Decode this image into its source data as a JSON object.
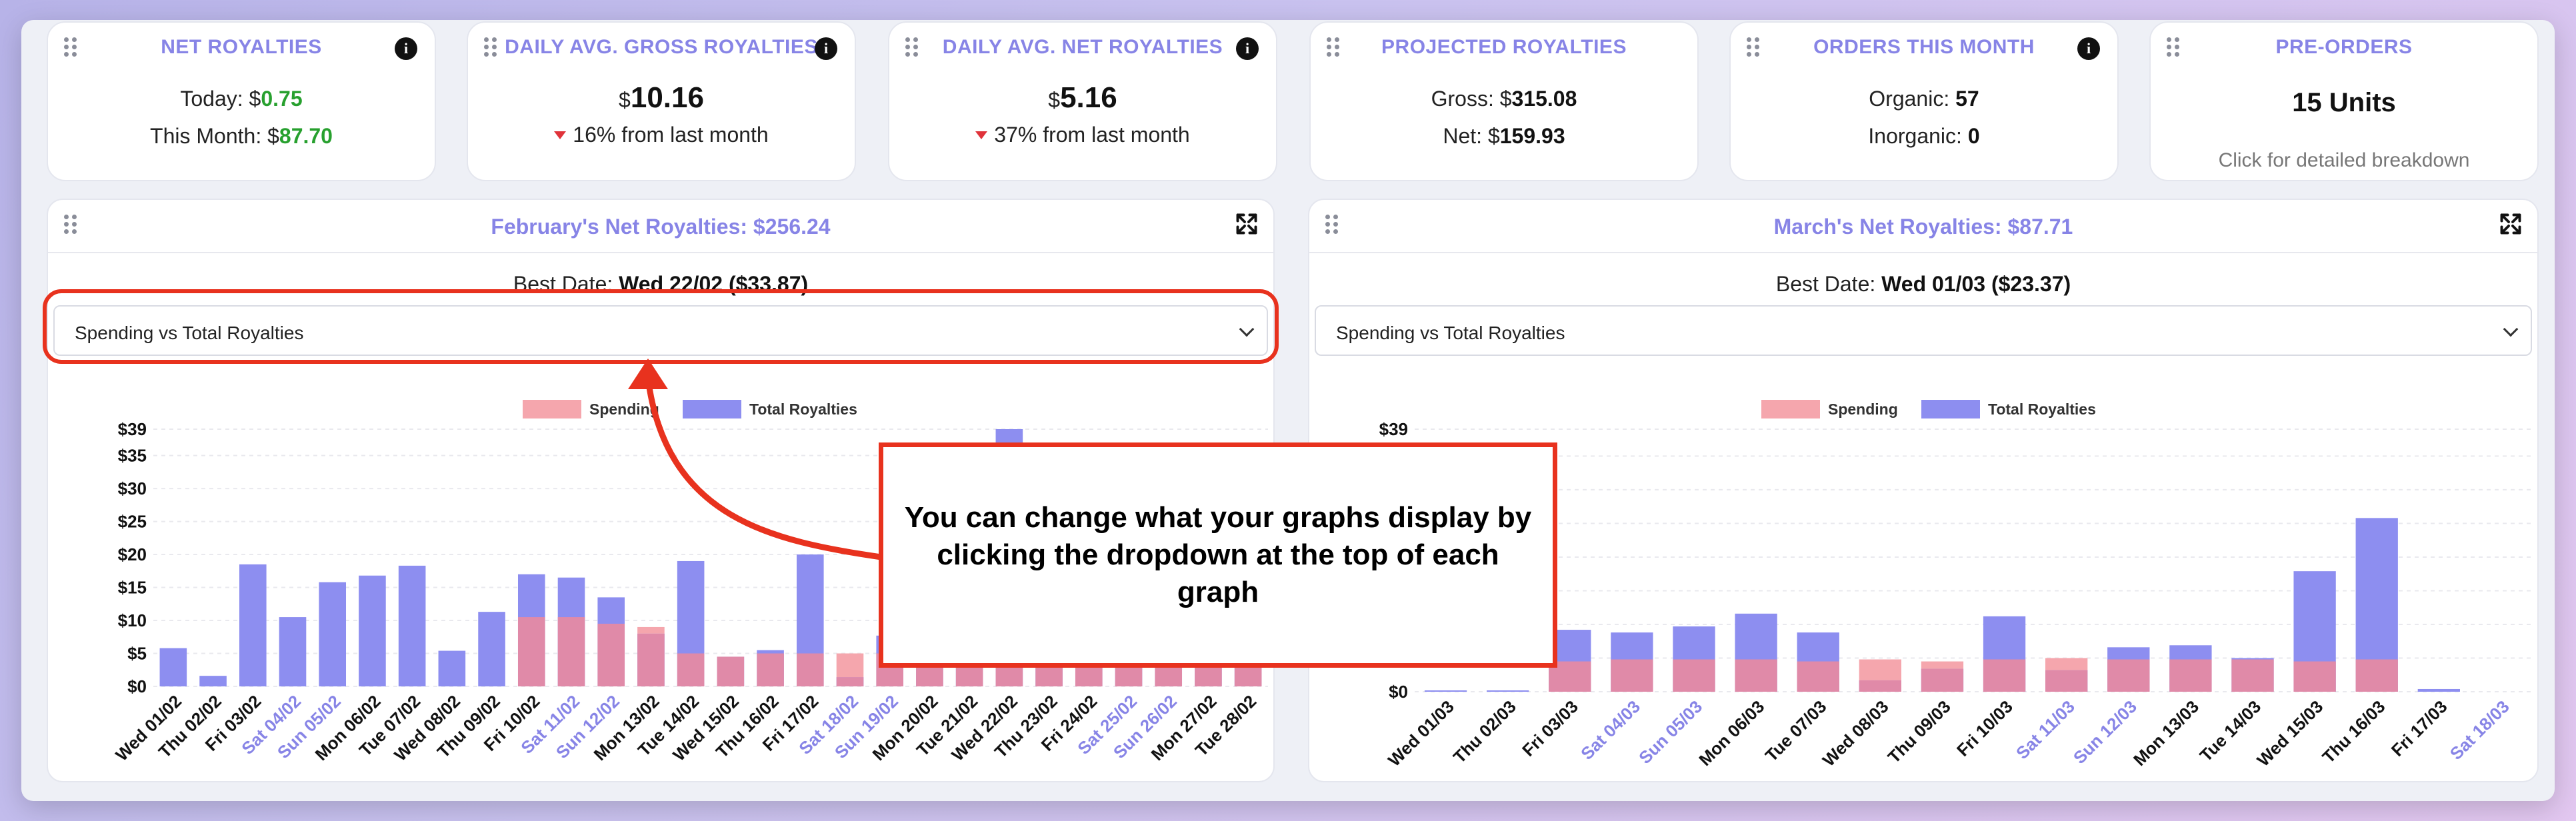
{
  "stats": {
    "net": {
      "title": "NET ROYALTIES",
      "today_label": "Today: $",
      "today_value": "0.75",
      "month_label": "This Month: $",
      "month_value": "87.70"
    },
    "gross": {
      "title": "DAILY AVG. GROSS ROYALTIES",
      "value_prefix": "$",
      "value": "10.16",
      "change": "16% from last month"
    },
    "netavg": {
      "title": "DAILY AVG. NET ROYALTIES",
      "value_prefix": "$",
      "value": "5.16",
      "change": "37% from last month"
    },
    "projected": {
      "title": "PROJECTED ROYALTIES",
      "gross_label": "Gross: $",
      "gross_value": "315.08",
      "net_label": "Net: $",
      "net_value": "159.93"
    },
    "orders": {
      "title": "ORDERS THIS MONTH",
      "organic_label": "Organic: ",
      "organic_value": "57",
      "inorganic_label": "Inorganic: ",
      "inorganic_value": "0"
    },
    "preorders": {
      "title": "PRE-ORDERS",
      "value": "15 Units",
      "hint": "Click for detailed breakdown"
    }
  },
  "graph_left": {
    "title_prefix": "February's Net Royalties: $",
    "title_value": "256.24",
    "best_label": "Best Date: ",
    "best_value": "Wed 22/02 ($33.87)",
    "select_value": "Spending vs Total Royalties"
  },
  "graph_right": {
    "title_prefix": "March's Net Royalties: $",
    "title_value": "87.71",
    "best_label": "Best Date: ",
    "best_value": "Wed 01/03 ($23.37)",
    "select_value": "Spending vs Total Royalties"
  },
  "callout": {
    "text": "You can change what your graphs display by clicking the dropdown at the top of each graph"
  },
  "colors": {
    "accent": "#8784e6",
    "spending": "#f5a6ad",
    "royalties": "#8d8ef0",
    "overlap": "#e08aa8",
    "highlight": "#e8321e",
    "weekend_label": "#8784e6"
  },
  "chart_data": [
    {
      "type": "bar",
      "legend": [
        "Spending",
        "Total Royalties"
      ],
      "ticks": [
        "$0",
        "$5",
        "$10",
        "$15",
        "$20",
        "$25",
        "$30",
        "$35",
        "$39"
      ],
      "ylim": [
        0,
        39
      ],
      "categories": [
        "Wed 01/02",
        "Thu 02/02",
        "Fri 03/02",
        "Sat 04/02",
        "Sun 05/02",
        "Mon 06/02",
        "Tue 07/02",
        "Wed 08/02",
        "Thu 09/02",
        "Fri 10/02",
        "Sat 11/02",
        "Sun 12/02",
        "Mon 13/02",
        "Tue 14/02",
        "Wed 15/02",
        "Thu 16/02",
        "Fri 17/02",
        "Sat 18/02",
        "Sun 19/02",
        "Mon 20/02",
        "Tue 21/02",
        "Wed 22/02",
        "Thu 23/02",
        "Fri 24/02",
        "Sat 25/02",
        "Sun 26/02",
        "Mon 27/02",
        "Tue 28/02"
      ],
      "weekend": [
        3,
        4,
        10,
        11,
        17,
        18,
        24,
        25
      ],
      "series": [
        {
          "name": "Spending",
          "values": [
            0,
            0,
            0,
            0,
            0,
            0,
            0,
            0,
            0,
            10.5,
            10.5,
            9.5,
            9,
            5,
            4.5,
            5,
            5,
            5,
            5,
            5,
            5,
            5,
            5,
            5,
            5,
            5,
            5,
            5
          ]
        },
        {
          "name": "Total Royalties",
          "values": [
            5.8,
            1.6,
            18.5,
            10.5,
            15.8,
            16.8,
            18.3,
            5.4,
            11.3,
            17,
            16.5,
            13.5,
            8,
            19,
            4.5,
            5.5,
            20,
            1.4,
            7.7,
            6,
            6,
            39,
            9,
            8,
            7,
            6,
            6,
            5
          ]
        }
      ]
    },
    {
      "type": "bar",
      "legend": [
        "Spending",
        "Total Royalties"
      ],
      "ticks": [
        "$0",
        "$5",
        "$10",
        "$15",
        "$20",
        "$25",
        "$30",
        "$35",
        "$39"
      ],
      "ylim": [
        0,
        39
      ],
      "categories": [
        "Wed 01/03",
        "Thu 02/03",
        "Fri 03/03",
        "Sat 04/03",
        "Sun 05/03",
        "Mon 06/03",
        "Tue 07/03",
        "Wed 08/03",
        "Thu 09/03",
        "Fri 10/03",
        "Sat 11/03",
        "Sun 12/03",
        "Mon 13/03",
        "Tue 14/03",
        "Wed 15/03",
        "Thu 16/03",
        "Fri 17/03",
        "Sat 18/03"
      ],
      "weekend": [
        3,
        4,
        10,
        11,
        17
      ],
      "series": [
        {
          "name": "Spending",
          "values": [
            0,
            0,
            4.5,
            4.8,
            4.8,
            4.8,
            4.5,
            4.8,
            4.5,
            4.8,
            5,
            4.8,
            4.8,
            4.8,
            4.5,
            4.8,
            0,
            0
          ]
        },
        {
          "name": "Total Royalties",
          "values": [
            0.2,
            0.2,
            9.2,
            8.8,
            9.7,
            11.6,
            8.8,
            1.7,
            3.4,
            11.2,
            3.2,
            6.6,
            6.9,
            5,
            17.9,
            25.8,
            0.4,
            0
          ]
        }
      ]
    }
  ]
}
